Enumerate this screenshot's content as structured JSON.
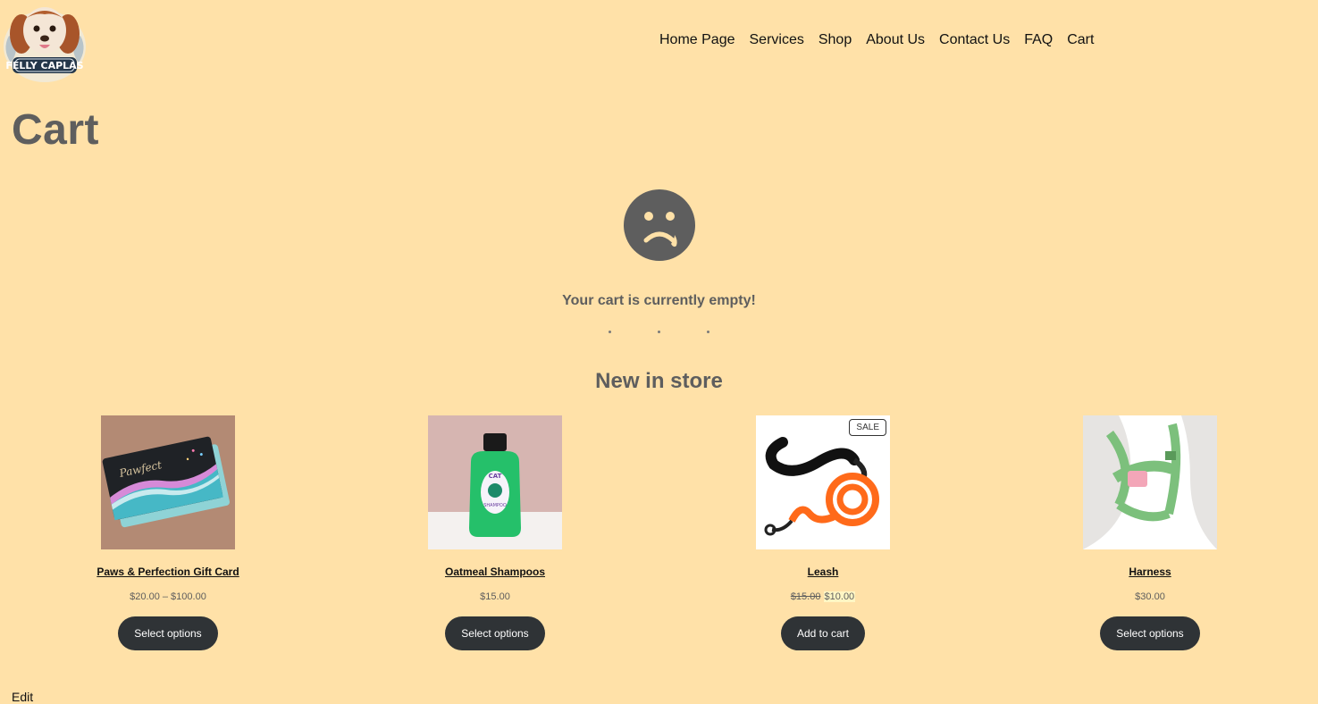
{
  "header": {
    "logo_text": "FELLY CAPLAS",
    "nav": [
      "Home Page",
      "Services",
      "Shop",
      "About Us",
      "Contact Us",
      "FAQ",
      "Cart"
    ]
  },
  "page": {
    "title": "Cart"
  },
  "empty_cart": {
    "icon": "sad-face-icon",
    "message": "Your cart is currently empty!"
  },
  "new_in_store": {
    "title": "New in store",
    "products": [
      {
        "name": "Paws & Perfection Gift Card",
        "price": "$20.00 – $100.00",
        "button": "Select options",
        "sale": false
      },
      {
        "name": "Oatmeal Shampoos",
        "price": "$15.00",
        "button": "Select options",
        "sale": false
      },
      {
        "name": "Leash",
        "old_price": "$15.00",
        "new_price": "$10.00",
        "button": "Add to cart",
        "sale": true,
        "badge": "SALE"
      },
      {
        "name": "Harness",
        "price": "$30.00",
        "button": "Select options",
        "sale": false
      }
    ]
  },
  "footer": {
    "edit_link": "Edit"
  },
  "colors": {
    "background": "#FFE1A8",
    "text": "#5e5e5e",
    "button": "#2f3336",
    "icon": "#5e5e5e"
  }
}
